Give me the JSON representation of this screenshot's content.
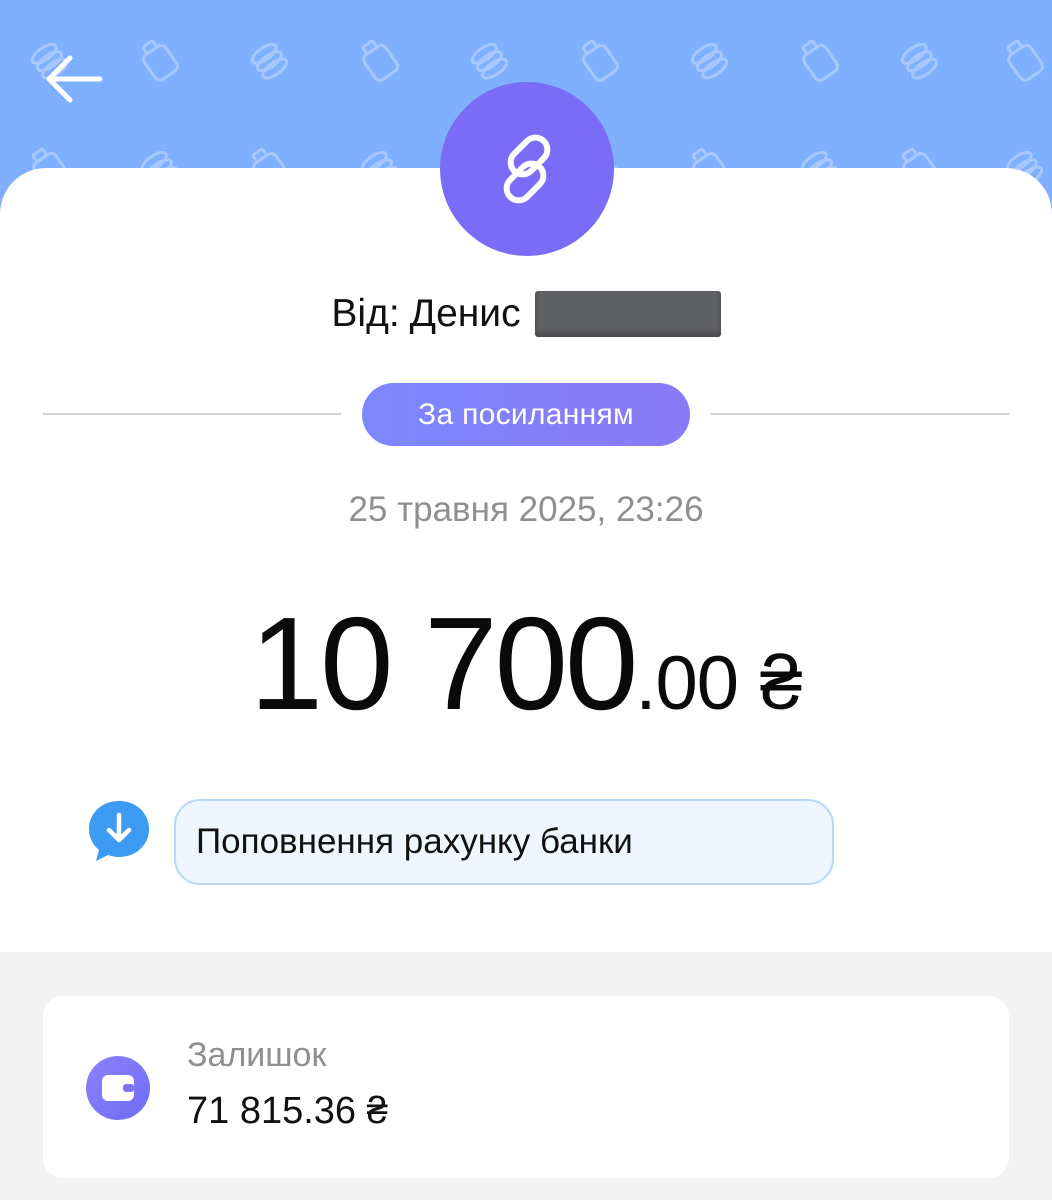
{
  "header": {
    "back_icon": "arrow-left-icon",
    "colors": {
      "background": "#7fafff",
      "pattern": "#a7c8ff"
    }
  },
  "transaction": {
    "type_icon": "link-icon",
    "avatar_color": "#7a6cf6",
    "from_label": "Від:",
    "from_name": "Денис",
    "from_surname_redacted": true,
    "badge_label": "За посиланням",
    "badge_color": "#8580f8",
    "datetime": "25 травня 2025, 23:26",
    "amount_integer": "10 700",
    "amount_decimal": ".00",
    "currency": "₴",
    "comment_icon": "comment-download-icon",
    "comment_text": "Поповнення рахунку банки"
  },
  "balance": {
    "icon": "wallet-icon",
    "label": "Залишок",
    "value": "71 815.36 ₴"
  }
}
